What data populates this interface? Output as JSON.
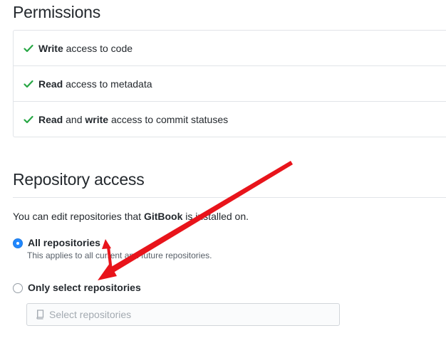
{
  "permissions": {
    "title": "Permissions",
    "items": [
      {
        "parts": [
          {
            "text": "Write",
            "bold": true
          },
          {
            "text": " access to code",
            "bold": false
          }
        ]
      },
      {
        "parts": [
          {
            "text": "Read",
            "bold": true
          },
          {
            "text": " access to metadata",
            "bold": false
          }
        ]
      },
      {
        "parts": [
          {
            "text": "Read",
            "bold": true
          },
          {
            "text": " and ",
            "bold": false
          },
          {
            "text": "write",
            "bold": true
          },
          {
            "text": " access to commit statuses",
            "bold": false
          }
        ]
      }
    ],
    "check_icon": "check-icon",
    "check_color": "#28a745"
  },
  "repository_access": {
    "title": "Repository access",
    "intro_prefix": "You can edit repositories that ",
    "intro_app": "GitBook",
    "intro_suffix": " is installed on.",
    "options": {
      "all": {
        "label": "All repositories",
        "note": "This applies to all current and future repositories.",
        "checked": true
      },
      "select": {
        "label": "Only select repositories",
        "checked": false
      }
    },
    "selector": {
      "placeholder": "Select repositories",
      "icon": "repo-icon"
    }
  },
  "annotation": {
    "color": "#e8141b",
    "icon": "arrow-annotation"
  }
}
